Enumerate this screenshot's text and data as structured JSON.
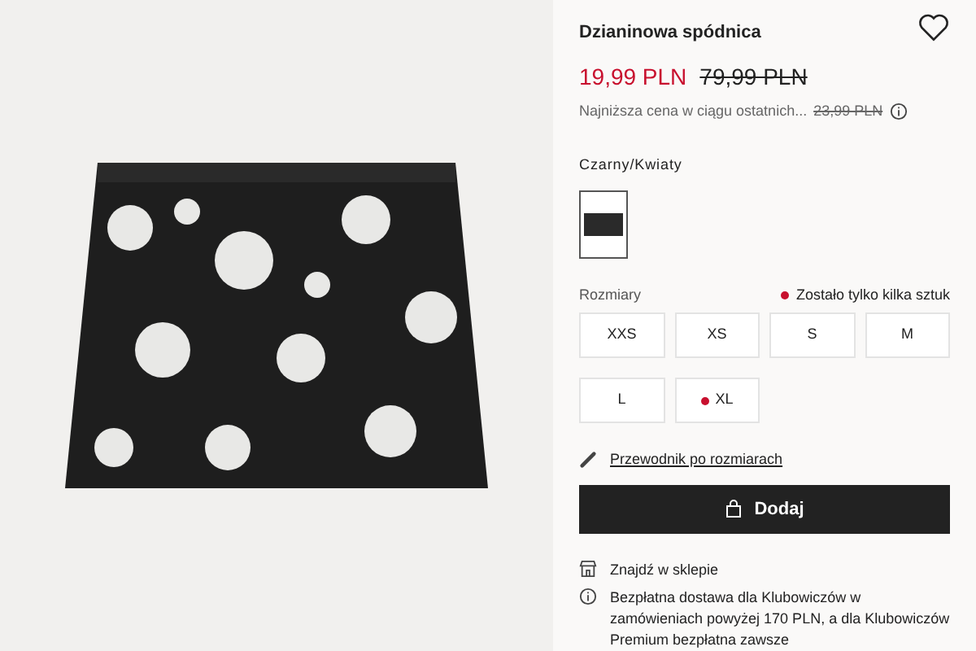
{
  "product": {
    "title": "Dzianinowa spódnica",
    "price": "19,99 PLN",
    "old_price": "79,99 PLN",
    "lowest_price_label": "Najniższa cena w ciągu ostatnich...",
    "lowest_price": "23,99 PLN",
    "favorite": false
  },
  "color": {
    "label": "Czarny/Kwiaty",
    "swatches": [
      {
        "selected": true
      }
    ]
  },
  "sizes": {
    "label": "Rozmiary",
    "low_stock_note": "Zostało tylko kilka sztuk",
    "items": [
      {
        "label": "XXS",
        "low_stock": false
      },
      {
        "label": "XS",
        "low_stock": false
      },
      {
        "label": "S",
        "low_stock": false
      },
      {
        "label": "M",
        "low_stock": false
      },
      {
        "label": "L",
        "low_stock": false
      },
      {
        "label": "XL",
        "low_stock": true
      }
    ]
  },
  "size_guide": "Przewodnik po rozmiarach",
  "add_button": "Dodaj",
  "info": [
    {
      "kind": "store",
      "text": "Znajdź w sklepie"
    },
    {
      "kind": "info",
      "text": "Bezpłatna dostawa dla Klubowiczów w zamówieniach powyżej 170 PLN, a dla Klubowiczów Premium bezpłatna zawsze"
    }
  ]
}
